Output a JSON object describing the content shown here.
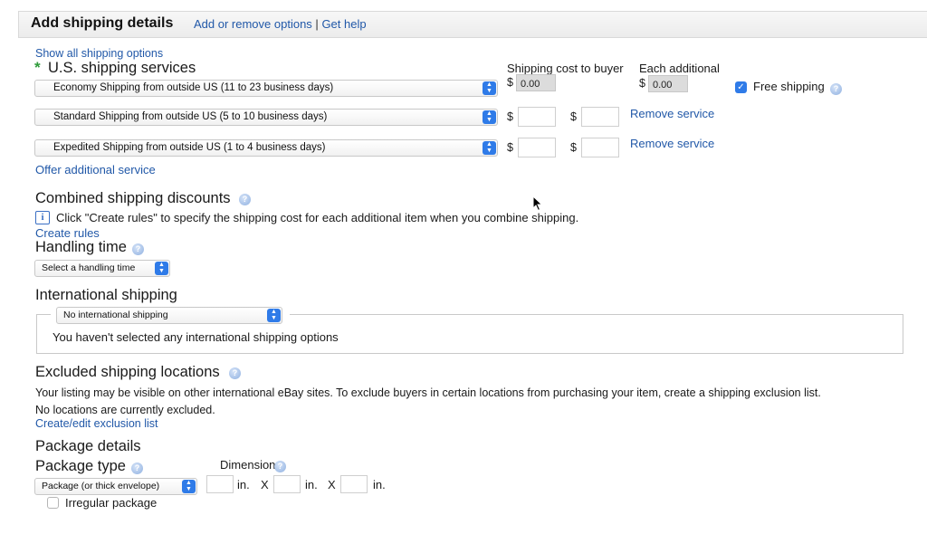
{
  "header": {
    "title": "Add shipping details",
    "add_remove_link": "Add or remove options",
    "separator": "|",
    "help_link": "Get help"
  },
  "domestic": {
    "show_all_link": "Show all shipping options",
    "required_marker": "*",
    "title": "U.S. shipping services",
    "col_cost": "Shipping cost to buyer",
    "col_each": "Each additional",
    "currency": "$",
    "services": [
      {
        "name": "Economy Shipping from outside US (11 to 23 business days)",
        "cost": "0.00",
        "each": "0.00"
      },
      {
        "name": "Standard Shipping from outside US (5 to 10 business days)",
        "cost": "",
        "each": "",
        "remove_label": "Remove service"
      },
      {
        "name": "Expedited Shipping from outside US (1 to 4 business days)",
        "cost": "",
        "each": "",
        "remove_label": "Remove service"
      }
    ],
    "free_shipping_label": "Free shipping",
    "free_shipping_checked": true,
    "offer_additional_link": "Offer additional service"
  },
  "combined": {
    "title": "Combined shipping discounts",
    "info_text": "Click \"Create rules\" to specify the shipping cost for each additional item when you combine shipping.",
    "create_rules_link": "Create rules"
  },
  "handling": {
    "title": "Handling time",
    "select_value": "Select a handling time"
  },
  "international": {
    "title": "International shipping",
    "select_value": "No international shipping",
    "message": "You haven't selected any international shipping options"
  },
  "excluded": {
    "title": "Excluded shipping locations",
    "description": "Your listing may be visible on other international eBay sites. To exclude buyers in certain locations from purchasing your item, create a shipping exclusion list.",
    "status": "No locations are currently excluded.",
    "edit_link": "Create/edit exclusion list"
  },
  "package": {
    "title": "Package details",
    "type_label": "Package type",
    "type_value": "Package (or thick envelope)",
    "dimensions_label": "Dimensions",
    "unit": "in.",
    "times": "X",
    "irregular_label": "Irregular package",
    "irregular_checked": false
  },
  "icons": {
    "stepper": "select-stepper-icon",
    "help": "help-icon",
    "info": "info-icon",
    "checkmark": "checkmark-icon"
  },
  "colors": {
    "link": "#2158a8",
    "accent": "#2f7be8",
    "required": "#2e9b3a"
  }
}
